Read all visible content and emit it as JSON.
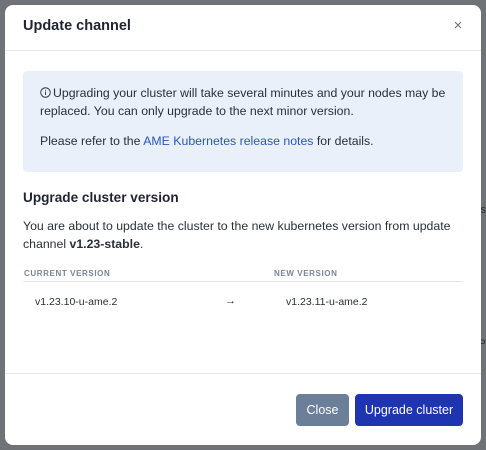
{
  "background": {
    "chars": [
      "s",
      "P",
      "-"
    ]
  },
  "modal": {
    "title": "Update channel",
    "close_icon": "×",
    "info": {
      "line1": "Upgrading your cluster will take several minutes and your nodes may be",
      "line2": "replaced. You can only upgrade to the next minor version.",
      "refer_prefix": "Please refer to the ",
      "refer_link": "AME Kubernetes release notes",
      "refer_suffix": " for details."
    },
    "section_title": "Upgrade cluster version",
    "description": {
      "line1": "You are about to update the cluster to the new kubernetes version from update",
      "line2_prefix": "channel ",
      "channel": "v1.23-stable",
      "line2_suffix": "."
    },
    "versions": {
      "headers": [
        "CURRENT VERSION",
        "NEW VERSION"
      ],
      "current": "v1.23.10-u-ame.2",
      "arrow": "→",
      "new": "v1.23.11-u-ame.2"
    },
    "buttons": {
      "close": "Close",
      "upgrade": "Upgrade cluster"
    }
  },
  "colors": {
    "primary": "#1e34b0",
    "secondary": "#6c7f99",
    "info_bg": "#e9f0f9",
    "link": "#2a56b8"
  }
}
